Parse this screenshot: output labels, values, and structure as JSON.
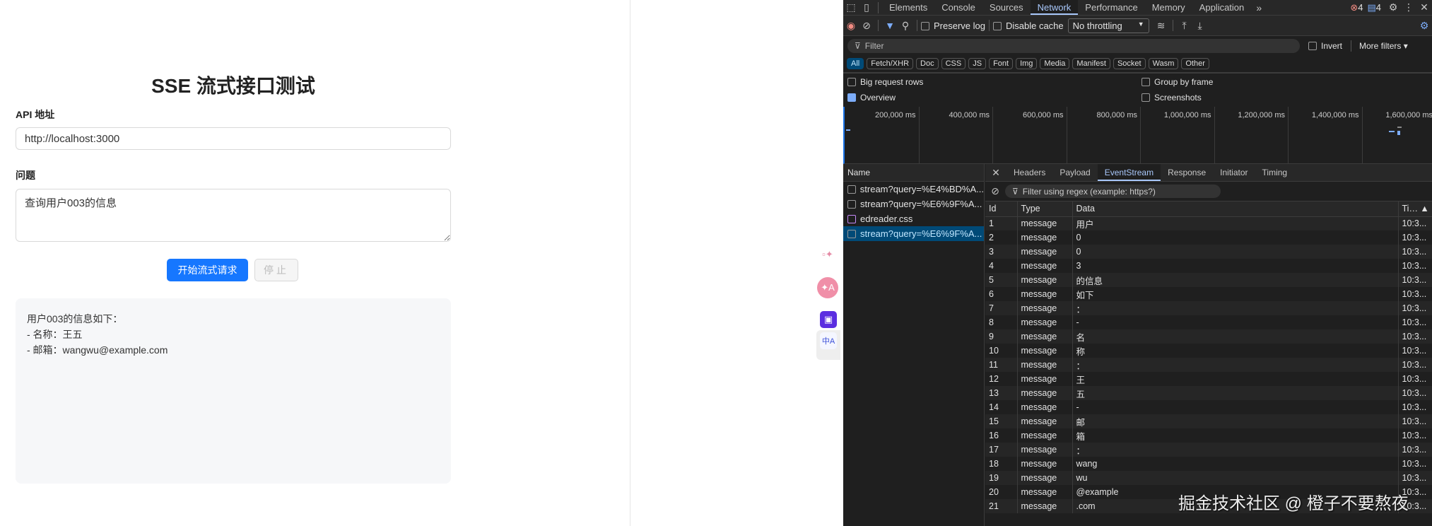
{
  "page": {
    "title": "SSE 流式接口测试",
    "api_label": "API 地址",
    "api_value": "http://localhost:3000",
    "question_label": "问题",
    "question_value": "查询用户003的信息",
    "start_button": "开始流式请求",
    "stop_button": "停止",
    "output_lines": [
      "用户003的信息如下：",
      "- 名称：王五",
      "- 邮箱：wangwu@example.com"
    ]
  },
  "devtools": {
    "tabs": [
      "Elements",
      "Console",
      "Sources",
      "Network",
      "Performance",
      "Memory",
      "Application"
    ],
    "active_tab": "Network",
    "error_count": "4",
    "message_count": "4",
    "toolbar": {
      "preserve_log": "Preserve log",
      "disable_cache": "Disable cache",
      "throttling": "No throttling"
    },
    "filter": {
      "placeholder": "Filter",
      "invert": "Invert",
      "more_filters": "More filters"
    },
    "type_filters": [
      "All",
      "Fetch/XHR",
      "Doc",
      "CSS",
      "JS",
      "Font",
      "Img",
      "Media",
      "Manifest",
      "Socket",
      "Wasm",
      "Other"
    ],
    "options": {
      "big_rows": "Big request rows",
      "group_by_frame": "Group by frame",
      "overview": "Overview",
      "screenshots": "Screenshots"
    },
    "timeline_ticks": [
      "200,000 ms",
      "400,000 ms",
      "600,000 ms",
      "800,000 ms",
      "1,000,000 ms",
      "1,200,000 ms",
      "1,400,000 ms",
      "1,600,000 ms"
    ],
    "name_header": "Name",
    "requests": [
      {
        "name": "stream?query=%E4%BD%A...",
        "type": "doc",
        "selected": false
      },
      {
        "name": "stream?query=%E6%9F%A...",
        "type": "doc",
        "selected": false
      },
      {
        "name": "edreader.css",
        "type": "css",
        "selected": false
      },
      {
        "name": "stream?query=%E6%9F%A...",
        "type": "doc",
        "selected": true
      }
    ],
    "detail_tabs": [
      "Headers",
      "Payload",
      "EventStream",
      "Response",
      "Initiator",
      "Timing"
    ],
    "active_detail_tab": "EventStream",
    "event_filter_placeholder": "Filter using regex (example: https?)",
    "columns": [
      "Id",
      "Type",
      "Data",
      "Ti… ▲"
    ],
    "events": [
      [
        "1",
        "message",
        "用户",
        "10:3..."
      ],
      [
        "2",
        "message",
        "0",
        "10:3..."
      ],
      [
        "3",
        "message",
        "0",
        "10:3..."
      ],
      [
        "4",
        "message",
        "3",
        "10:3..."
      ],
      [
        "5",
        "message",
        "的信息",
        "10:3..."
      ],
      [
        "6",
        "message",
        "如下",
        "10:3..."
      ],
      [
        "7",
        "message",
        "：",
        "10:3..."
      ],
      [
        "8",
        "message",
        "-",
        "10:3..."
      ],
      [
        "9",
        "message",
        "名",
        "10:3..."
      ],
      [
        "10",
        "message",
        "称",
        "10:3..."
      ],
      [
        "11",
        "message",
        "：",
        "10:3..."
      ],
      [
        "12",
        "message",
        "王",
        "10:3..."
      ],
      [
        "13",
        "message",
        "五",
        "10:3..."
      ],
      [
        "14",
        "message",
        "-",
        "10:3..."
      ],
      [
        "15",
        "message",
        "邮",
        "10:3..."
      ],
      [
        "16",
        "message",
        "箱",
        "10:3..."
      ],
      [
        "17",
        "message",
        "：",
        "10:3..."
      ],
      [
        "18",
        "message",
        "wang",
        "10:3..."
      ],
      [
        "19",
        "message",
        "wu",
        "10:3..."
      ],
      [
        "20",
        "message",
        "@example",
        "10:3..."
      ],
      [
        "21",
        "message",
        ".com",
        "10:3..."
      ]
    ]
  },
  "watermark": "掘金技术社区 @ 橙子不要熬夜"
}
